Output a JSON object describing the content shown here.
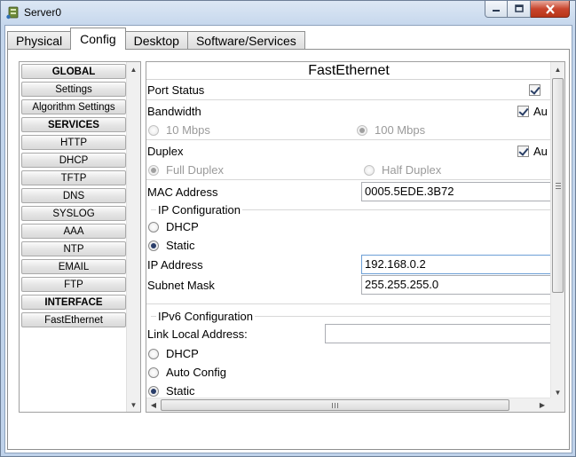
{
  "window": {
    "title": "Server0"
  },
  "tabs": [
    {
      "label": "Physical",
      "active": false
    },
    {
      "label": "Config",
      "active": true
    },
    {
      "label": "Desktop",
      "active": false
    },
    {
      "label": "Software/Services",
      "active": false
    }
  ],
  "nav": {
    "items": [
      {
        "label": "GLOBAL",
        "header": true
      },
      {
        "label": "Settings",
        "header": false
      },
      {
        "label": "Algorithm Settings",
        "header": false
      },
      {
        "label": "SERVICES",
        "header": true
      },
      {
        "label": "HTTP",
        "header": false
      },
      {
        "label": "DHCP",
        "header": false
      },
      {
        "label": "TFTP",
        "header": false
      },
      {
        "label": "DNS",
        "header": false
      },
      {
        "label": "SYSLOG",
        "header": false
      },
      {
        "label": "AAA",
        "header": false
      },
      {
        "label": "NTP",
        "header": false
      },
      {
        "label": "EMAIL",
        "header": false
      },
      {
        "label": "FTP",
        "header": false
      },
      {
        "label": "INTERFACE",
        "header": true
      },
      {
        "label": "FastEthernet",
        "header": false
      }
    ]
  },
  "panel": {
    "title": "FastEthernet",
    "port_status": {
      "label": "Port Status",
      "checked": true
    },
    "bandwidth": {
      "label": "Bandwidth",
      "auto_label": "Au",
      "auto_checked": true,
      "opt_10": "10 Mbps",
      "opt_100": "100 Mbps",
      "selected": "100 Mbps"
    },
    "duplex": {
      "label": "Duplex",
      "auto_label": "Au",
      "auto_checked": true,
      "opt_full": "Full Duplex",
      "opt_half": "Half Duplex",
      "selected": "Full Duplex"
    },
    "mac": {
      "label": "MAC Address",
      "value": "0005.5EDE.3B72"
    },
    "ip_config": {
      "label": "IP Configuration",
      "dhcp_label": "DHCP",
      "static_label": "Static",
      "selected": "Static"
    },
    "ip_address": {
      "label": "IP Address",
      "value": "192.168.0.2"
    },
    "subnet_mask": {
      "label": "Subnet Mask",
      "value": "255.255.255.0"
    },
    "ipv6_config": {
      "label": "IPv6 Configuration",
      "link_local_label": "Link Local Address:",
      "link_local_value": "",
      "dhcp_label": "DHCP",
      "auto_label": "Auto Config",
      "static_label": "Static",
      "selected": "Static"
    }
  }
}
